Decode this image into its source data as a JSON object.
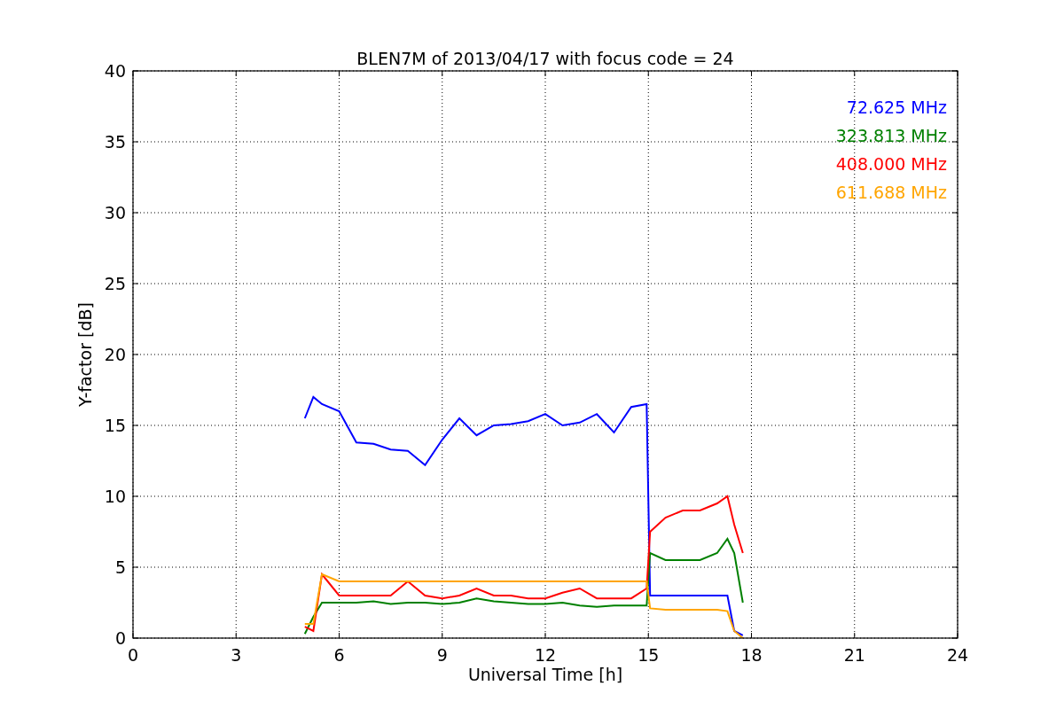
{
  "chart_data": {
    "type": "line",
    "title": "BLEN7M of 2013/04/17 with focus code = 24",
    "xlabel": "Universal Time [h]",
    "ylabel": "Y-factor [dB]",
    "x": [
      5,
      5.25,
      5.5,
      6,
      6.5,
      7,
      7.5,
      8,
      8.5,
      9,
      9.5,
      10,
      10.5,
      11,
      11.5,
      12,
      12.5,
      13,
      13.5,
      14,
      14.5,
      14.95,
      15.05,
      15.5,
      16,
      16.5,
      17,
      17.3,
      17.5,
      17.75
    ],
    "series": [
      {
        "name": "72.625 MHz",
        "color": "#0000ff",
        "values": [
          15.5,
          17,
          16.5,
          16,
          13.8,
          13.7,
          13.3,
          13.2,
          12.2,
          14,
          15.5,
          14.3,
          15,
          15.1,
          15.3,
          15.8,
          15,
          15.2,
          15.8,
          14.5,
          16.3,
          16.5,
          3,
          3,
          3,
          3,
          3,
          3,
          0.5,
          0.2
        ]
      },
      {
        "name": "323.813 MHz",
        "color": "#008000",
        "values": [
          0.3,
          1.5,
          2.5,
          2.5,
          2.5,
          2.6,
          2.4,
          2.5,
          2.5,
          2.4,
          2.5,
          2.8,
          2.6,
          2.5,
          2.4,
          2.4,
          2.5,
          2.3,
          2.2,
          2.3,
          2.3,
          2.3,
          6,
          5.5,
          5.5,
          5.5,
          6,
          7,
          6,
          2.5
        ]
      },
      {
        "name": "408.000 MHz",
        "color": "#ff0000",
        "values": [
          0.8,
          0.5,
          4.5,
          3,
          3,
          3,
          3,
          4,
          3,
          2.8,
          3,
          3.5,
          3,
          3,
          2.8,
          2.8,
          3.2,
          3.5,
          2.8,
          2.8,
          2.8,
          3.5,
          7.5,
          8.5,
          9,
          9,
          9.5,
          10,
          8,
          6
        ]
      },
      {
        "name": "611.688 MHz",
        "color": "#ffa500",
        "values": [
          1,
          1,
          4.5,
          4,
          4,
          4,
          4,
          4,
          4,
          4,
          4,
          4,
          4,
          4,
          4,
          4,
          4,
          4,
          4,
          4,
          4,
          4,
          2.1,
          2,
          2,
          2,
          2,
          1.9,
          0.5,
          0
        ]
      }
    ],
    "xlim": [
      0,
      24
    ],
    "ylim": [
      0,
      40
    ],
    "xticks": [
      0,
      3,
      6,
      9,
      12,
      15,
      18,
      21,
      24
    ],
    "yticks": [
      0,
      5,
      10,
      15,
      20,
      25,
      30,
      35,
      40
    ],
    "grid": true
  }
}
